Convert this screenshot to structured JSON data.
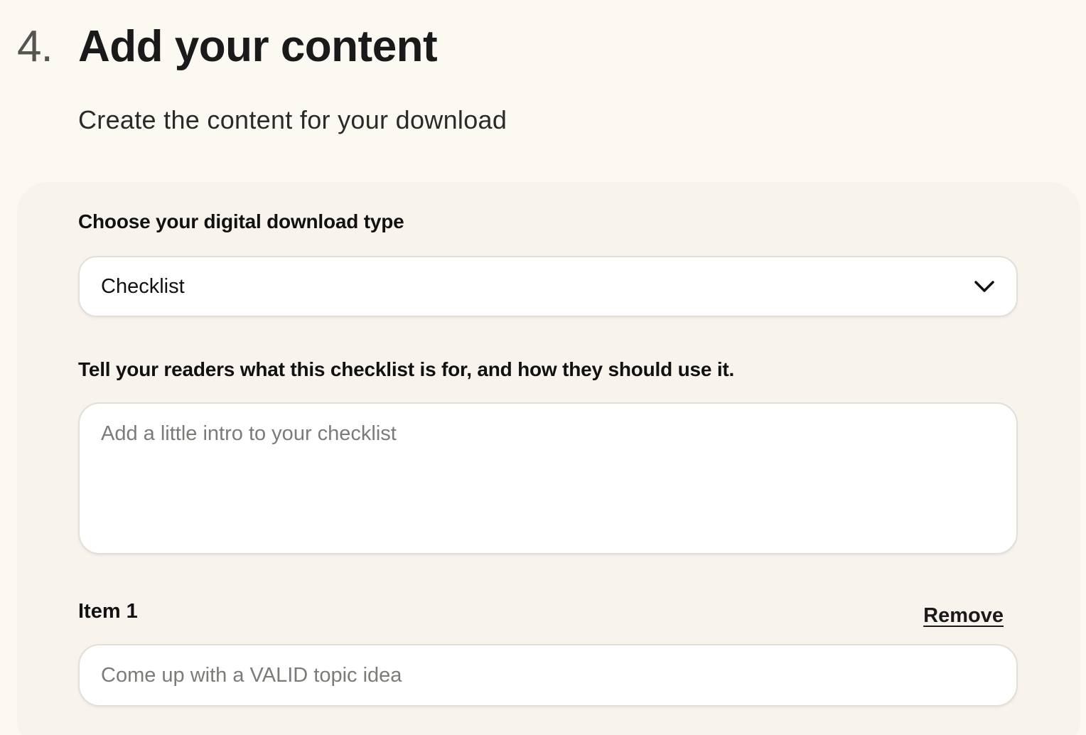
{
  "step": {
    "number": "4.",
    "title": "Add your content",
    "subtitle": "Create the content for your download"
  },
  "download_type": {
    "label": "Choose your digital download type",
    "selected_value": "Checklist",
    "icon": "chevron-down-icon"
  },
  "intro": {
    "label": "Tell your readers what this checklist is for, and how they should use it.",
    "placeholder": "Add a little intro to your checklist",
    "value": ""
  },
  "items": [
    {
      "label": "Item 1",
      "remove_label": "Remove",
      "placeholder": "Come up with a VALID topic idea",
      "value": ""
    }
  ],
  "colors": {
    "page_background": "#fcf9f3",
    "card_background": "#f8f3ec",
    "input_background": "#ffffff",
    "input_border": "#e2ded8",
    "placeholder_text": "#7d7b78"
  }
}
